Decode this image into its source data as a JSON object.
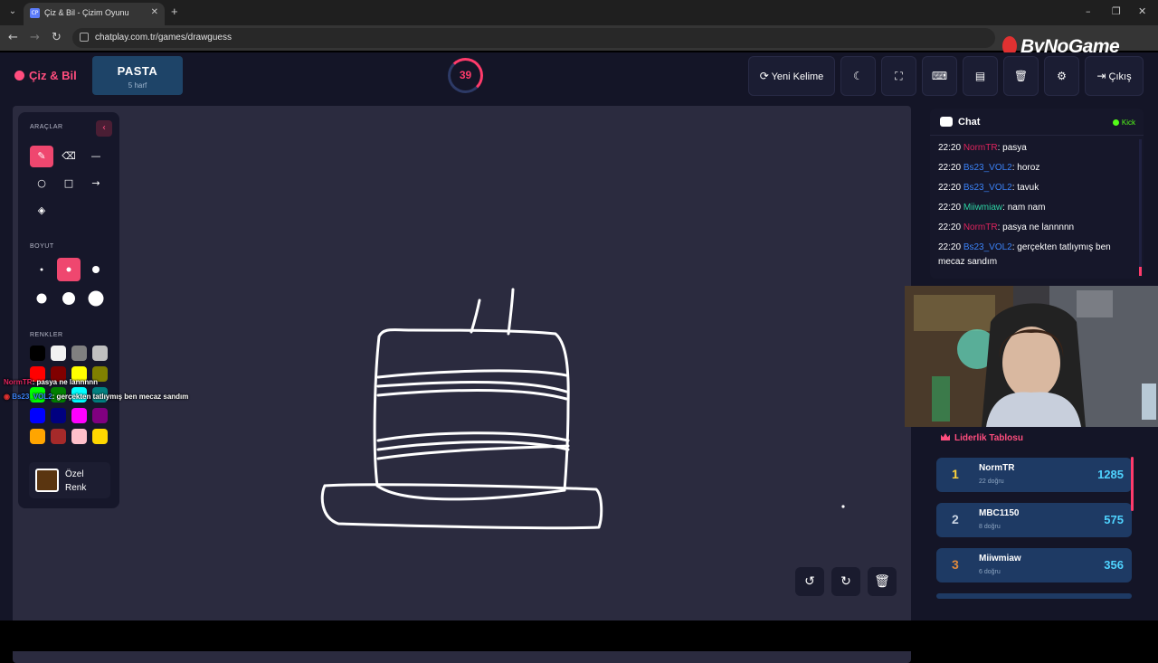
{
  "browser": {
    "tab_title": "Çiz & Bil - Çizim Oyunu",
    "tab_favicon": "CP",
    "url": "chatplay.com.tr/games/drawguess"
  },
  "brand_overlay": "ByNoGame",
  "header": {
    "logo": "Çiz & Bil",
    "word": "PASTA",
    "word_length": "5 harf",
    "timer": "39",
    "new_word": "Yeni Kelime",
    "exit": "Çıkış"
  },
  "tools": {
    "tools_label": "ARAÇLAR",
    "size_label": "BOYUT",
    "colors_label": "RENKLER",
    "custom_color_label": "Özel Renk",
    "custom_color": "#5a3510",
    "colors": [
      "#000000",
      "#f2f2f2",
      "#808080",
      "#c0c0c0",
      "#ff0000",
      "#800000",
      "#ffff00",
      "#808000",
      "#00ff00",
      "#008000",
      "#00ffff",
      "#008080",
      "#0000ff",
      "#000080",
      "#ff00ff",
      "#800080",
      "#ffa500",
      "#a52a2a",
      "#ffc0cb",
      "#ffd700"
    ]
  },
  "overlay_messages": [
    {
      "user": "NormTR",
      "text": ": pasya ne lannnnn",
      "color": "#e0245e"
    },
    {
      "user": "Bs23_VOL2",
      "text": ": gerçekten tatlıymış ben mecaz sandım",
      "color": "#3b82f6"
    }
  ],
  "chat": {
    "title": "Chat",
    "platform": "Kick",
    "messages": [
      {
        "time": "22:20",
        "user": "NormTR",
        "user_color": "#e0245e",
        "text": ": pasya"
      },
      {
        "time": "22:20",
        "user": "Bs23_VOL2",
        "user_color": "#3b82f6",
        "text": ": horoz"
      },
      {
        "time": "22:20",
        "user": "Bs23_VOL2",
        "user_color": "#3b82f6",
        "text": ": tavuk"
      },
      {
        "time": "22:20",
        "user": "Miiwmiaw",
        "user_color": "#2dd4a4",
        "text": ": nam nam"
      },
      {
        "time": "22:20",
        "user": "NormTR",
        "user_color": "#e0245e",
        "text": ": pasya ne lannnnn"
      },
      {
        "time": "22:20",
        "user": "Bs23_VOL2",
        "user_color": "#3b82f6",
        "text": ": gerçekten tatlıymış ben mecaz sandım"
      }
    ]
  },
  "leaderboard": {
    "title": "Liderlik Tablosu",
    "rows": [
      {
        "rank": "1",
        "name": "NormTR",
        "correct": "22 doğru",
        "score": "1285",
        "rank_color": "#ffd43b"
      },
      {
        "rank": "2",
        "name": "MBC1150",
        "correct": "8 doğru",
        "score": "575",
        "rank_color": "#c9d4e3"
      },
      {
        "rank": "3",
        "name": "Miiwmiaw",
        "correct": "6 doğru",
        "score": "356",
        "rank_color": "#e08a3c"
      }
    ]
  }
}
